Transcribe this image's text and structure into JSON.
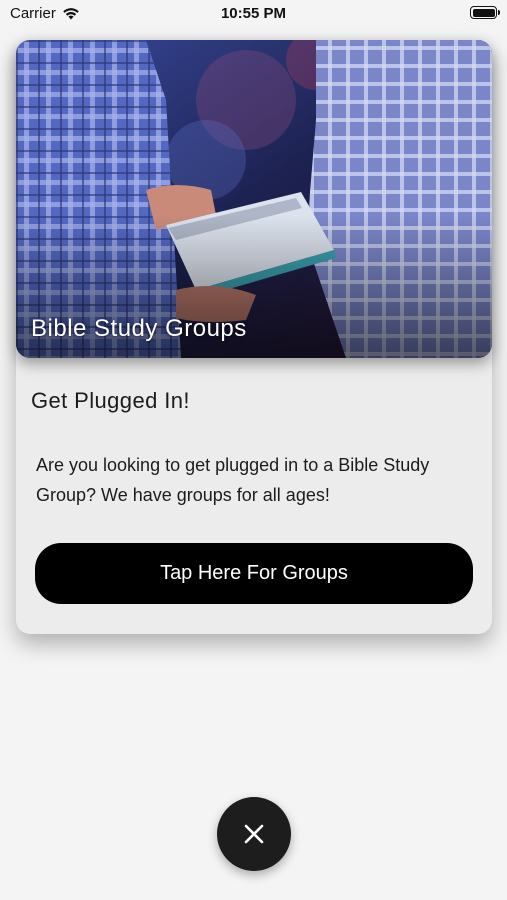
{
  "status_bar": {
    "carrier": "Carrier",
    "time": "10:55 PM",
    "wifi_icon": "wifi-icon",
    "battery_icon": "battery-icon",
    "battery_level": 1.0
  },
  "card": {
    "hero_image": "people-reading-bible",
    "hero_title": "Bible Study Groups",
    "heading": "Get Plugged In!",
    "body": "Are you looking to get plugged in to a Bible Study Group? We have groups for all ages!",
    "button_label": "Tap Here For Groups"
  },
  "close_button": {
    "icon": "close-icon"
  },
  "colors": {
    "background": "#f4f4f4",
    "card": "#ececec",
    "button": "#000000",
    "fab": "#1d1d1d",
    "hero_tint": "#2a2f6e"
  }
}
